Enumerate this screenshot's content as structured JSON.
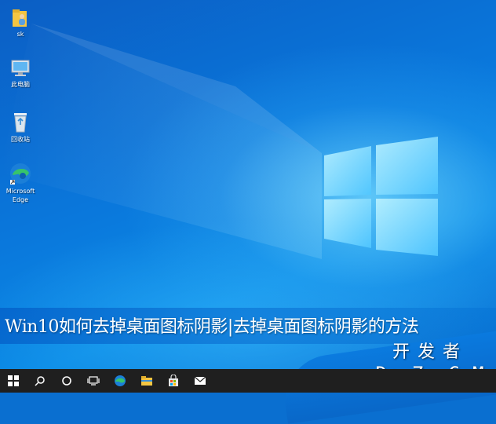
{
  "desktop_icons": [
    {
      "label": "sk",
      "icon": "user-folder-icon"
    },
    {
      "label": "此电脑",
      "icon": "this-pc-icon"
    },
    {
      "label": "回收站",
      "icon": "recycle-bin-icon"
    },
    {
      "label": "Microsoft Edge",
      "icon": "edge-icon"
    }
  ],
  "caption": "Win10如何去掉桌面图标阴影|去掉桌面图标阴影的方法",
  "watermark": {
    "top": "开发者",
    "bottom": "DevZe.CoM"
  },
  "taskbar": {
    "items": [
      "windows-start-icon",
      "search-icon",
      "cortana-icon",
      "task-view-icon",
      "edge-icon",
      "file-explorer-icon",
      "store-icon",
      "mail-icon"
    ]
  },
  "colors": {
    "taskbar": "#1f1f1f",
    "desktop": "#0a78dc",
    "logo": "#8fe3ff"
  }
}
